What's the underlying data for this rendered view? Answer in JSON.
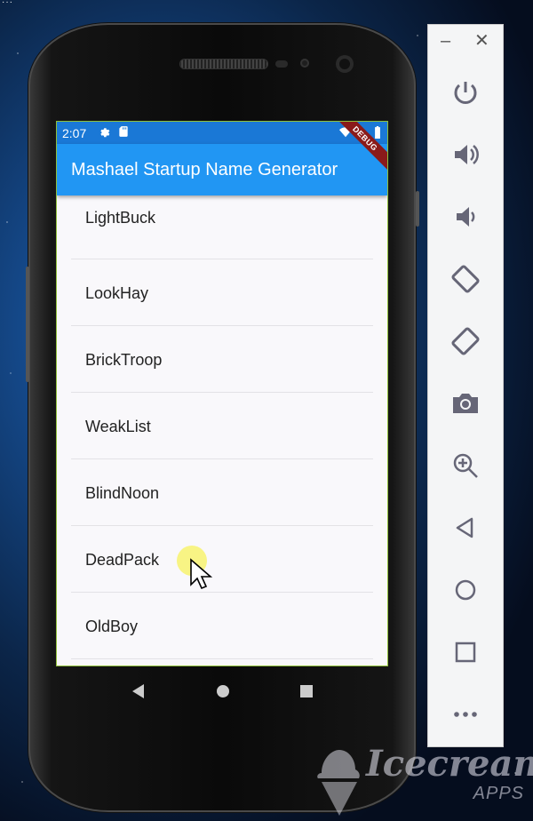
{
  "status_bar": {
    "time": "2:07"
  },
  "app": {
    "title": "Mashael Startup Name Generator",
    "debug_banner": "DEBUG"
  },
  "names": [
    "LightBuck",
    "LookHay",
    "BrickTroop",
    "WeakList",
    "BlindNoon",
    "DeadPack",
    "OldBoy"
  ],
  "emulator_panel": {
    "buttons": [
      "power-icon",
      "volume-up-icon",
      "volume-down-icon",
      "rotate-left-icon",
      "rotate-right-icon",
      "camera-icon",
      "zoom-icon",
      "back-icon",
      "home-icon",
      "overview-icon",
      "more-icon"
    ]
  },
  "watermark": {
    "name": "Icecream",
    "sub": "APPS"
  },
  "colors": {
    "app_bar": "#2196f3",
    "status_bar": "#1a78d6",
    "list_bg": "#f9f8fb"
  }
}
